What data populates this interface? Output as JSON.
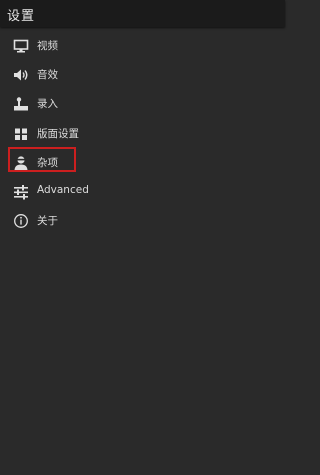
{
  "header": {
    "title": "设置"
  },
  "menu": {
    "items": [
      {
        "label": "视频",
        "icon": "monitor-icon"
      },
      {
        "label": "音效",
        "icon": "speaker-icon"
      },
      {
        "label": "录入",
        "icon": "joystick-icon"
      },
      {
        "label": "版面设置",
        "icon": "grid-icon"
      },
      {
        "label": "杂项",
        "icon": "person-icon"
      },
      {
        "label": "Advanced",
        "icon": "sliders-icon"
      },
      {
        "label": "关于",
        "icon": "info-icon"
      }
    ]
  },
  "colors": {
    "background": "#2a2a2a",
    "titlebar": "#1b1b1b",
    "text": "#dcdcdc",
    "highlight": "#cc1f1f"
  }
}
